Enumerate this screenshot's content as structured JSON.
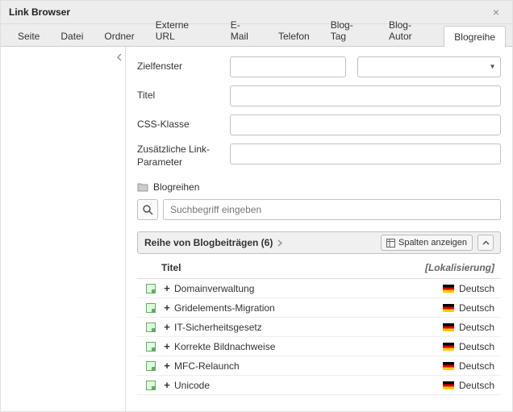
{
  "window": {
    "title": "Link Browser"
  },
  "tabs": [
    {
      "label": "Seite"
    },
    {
      "label": "Datei"
    },
    {
      "label": "Ordner"
    },
    {
      "label": "Externe URL"
    },
    {
      "label": "E-Mail"
    },
    {
      "label": "Telefon"
    },
    {
      "label": "Blog-Tag"
    },
    {
      "label": "Blog-Autor"
    },
    {
      "label": "Blogreihe",
      "active": true
    }
  ],
  "form": {
    "target_label": "Zielfenster",
    "target_value": "",
    "target_select_value": "",
    "title_label": "Titel",
    "title_value": "",
    "css_label": "CSS-Klasse",
    "css_value": "",
    "params_label": "Zusätzliche Link-Parameter",
    "params_value": ""
  },
  "list": {
    "heading": "Blogreihen",
    "search_placeholder": "Suchbegriff eingeben",
    "section_label": "Reihe von Blogbeiträgen (6)",
    "columns_button": "Spalten anzeigen",
    "columns": {
      "title": "Titel",
      "localization": "[Lokalisierung]"
    },
    "rows": [
      {
        "title": "Domainverwaltung",
        "lang": "Deutsch"
      },
      {
        "title": "Gridelements-Migration",
        "lang": "Deutsch"
      },
      {
        "title": "IT-Sicherheitsgesetz",
        "lang": "Deutsch"
      },
      {
        "title": "Korrekte Bildnachweise",
        "lang": "Deutsch"
      },
      {
        "title": "MFC-Relaunch",
        "lang": "Deutsch"
      },
      {
        "title": "Unicode",
        "lang": "Deutsch"
      }
    ]
  }
}
